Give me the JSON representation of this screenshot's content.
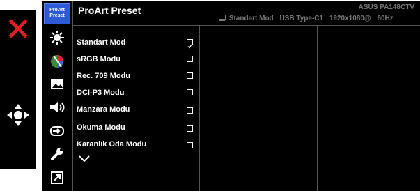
{
  "header": {
    "title": "ProArt Preset",
    "model": "ASUS PA148CTV",
    "status": [
      "Standart Mod",
      "USB Type-C1",
      "1920x1080@",
      "60Hz"
    ]
  },
  "tab": {
    "label": "ProArt Preset"
  },
  "menu": {
    "items": [
      {
        "label": "Standart Mod",
        "checked": true
      },
      {
        "label": "sRGB Modu",
        "checked": false
      },
      {
        "label": "Rec. 709 Modu",
        "checked": false
      },
      {
        "label": "DCI-P3 Modu",
        "checked": false
      },
      {
        "label": "Manzara Modu",
        "checked": false
      },
      {
        "label": "Okuma Modu",
        "checked": false
      },
      {
        "label": "Karanlık Oda Modu",
        "checked": false
      }
    ]
  },
  "icons": [
    "brightness-icon",
    "color-icon",
    "image-icon",
    "sound-icon",
    "input-select-icon",
    "system-setup-icon",
    "shortcut-icon"
  ],
  "keys": [
    "close-icon",
    "five-way-joystick-icon"
  ]
}
